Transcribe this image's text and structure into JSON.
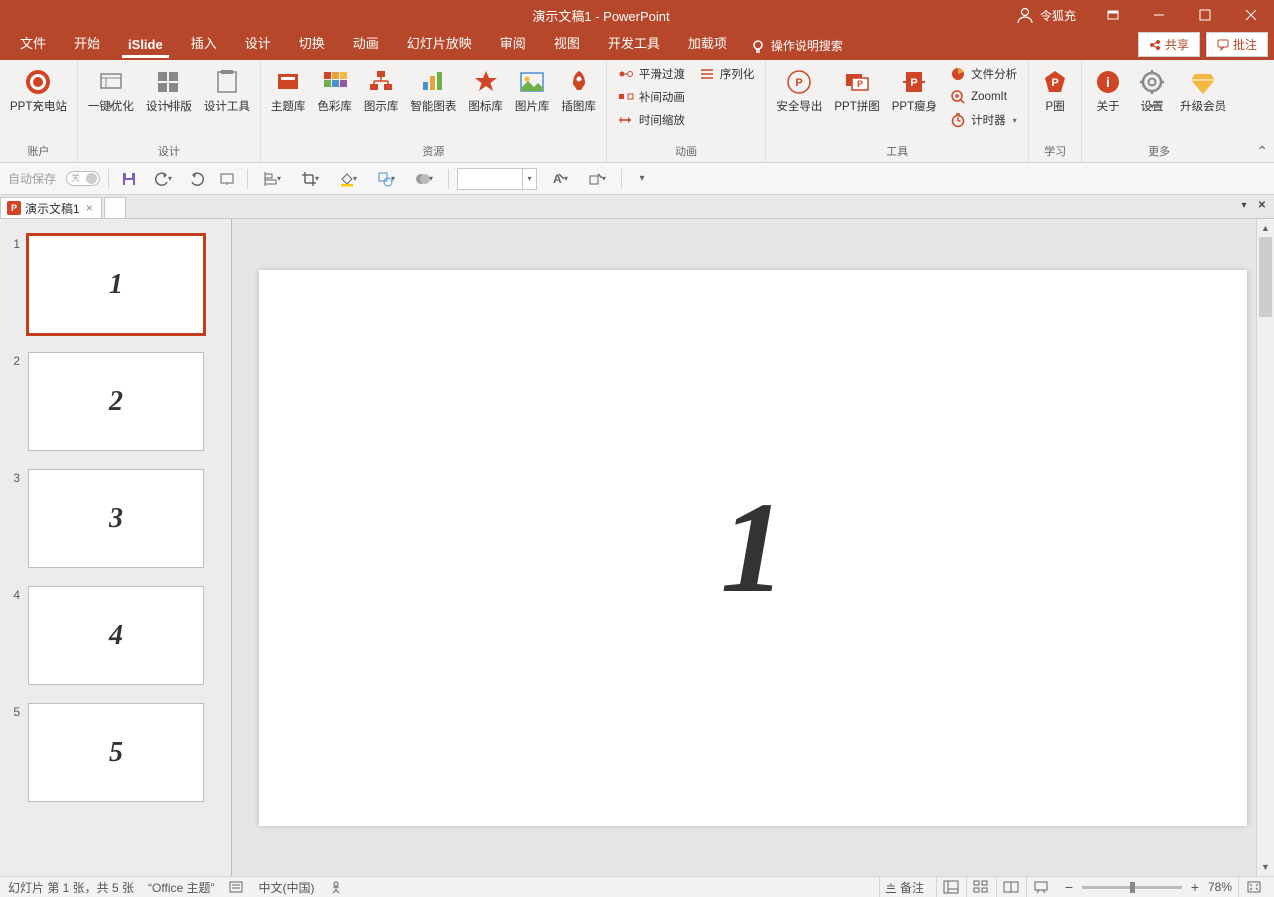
{
  "titlebar": {
    "document": "演示文稿1",
    "app": "PowerPoint",
    "full": "演示文稿1  -  PowerPoint",
    "user": "令狐充"
  },
  "menus": {
    "file": "文件",
    "home": "开始",
    "islide": "iSlide",
    "insert": "插入",
    "design": "设计",
    "transitions": "切换",
    "animations": "动画",
    "slideshow": "幻灯片放映",
    "review": "审阅",
    "view": "视图",
    "devtools": "开发工具",
    "addins": "加载项",
    "search_hint": "操作说明搜索",
    "share": "共享",
    "comments": "批注"
  },
  "ribbon": {
    "account": {
      "ppt_station": "PPT充电站",
      "label": "账户"
    },
    "design_group": {
      "optimize": "一键优化",
      "layout": "设计排版",
      "tools": "设计工具",
      "label": "设计"
    },
    "resource": {
      "theme": "主题库",
      "color": "色彩库",
      "diagram": "图示库",
      "smartchart": "智能图表",
      "icon": "图标库",
      "image": "图片库",
      "illustration": "插图库",
      "label": "资源"
    },
    "anim": {
      "smooth": "平滑过渡",
      "sequence": "序列化",
      "tween": "补间动画",
      "timescale": "时间缩放",
      "label": "动画"
    },
    "tools": {
      "export": "安全导出",
      "pptjoin": "PPT拼图",
      "pptslim": "PPT瘦身",
      "fileanalysis": "文件分析",
      "zoomit": "ZoomIt",
      "timer": "计时器",
      "label": "工具"
    },
    "learn": {
      "pquan": "P圈",
      "label": "学习"
    },
    "more": {
      "about": "关于",
      "settings": "设置",
      "upgrade": "升级会员",
      "label": "更多"
    }
  },
  "qat": {
    "autosave": "自动保存",
    "off_glyph": "关"
  },
  "doctab": {
    "name": "演示文稿1"
  },
  "slides": [
    {
      "num": "1",
      "content": "1",
      "selected": true
    },
    {
      "num": "2",
      "content": "2",
      "selected": false
    },
    {
      "num": "3",
      "content": "3",
      "selected": false
    },
    {
      "num": "4",
      "content": "4",
      "selected": false
    },
    {
      "num": "5",
      "content": "5",
      "selected": false
    }
  ],
  "canvas": {
    "content": "1"
  },
  "status": {
    "slide_info": "幻灯片 第 1 张，共 5 张",
    "theme": "“Office 主题”",
    "language": "中文(中国)",
    "notes": "备注",
    "zoom": "78%"
  }
}
